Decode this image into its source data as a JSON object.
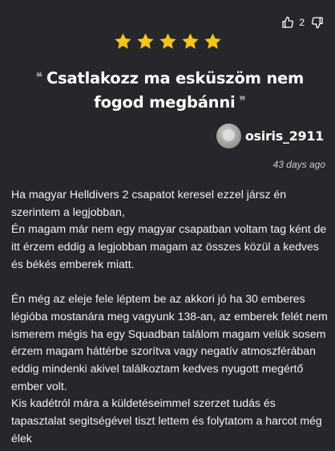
{
  "review": {
    "vote_count": "2",
    "rating": 5,
    "title": "Csatlakozz ma esküszöm nem fogod megbánni",
    "author": "osiris_2911",
    "date": "43 days ago",
    "body": "Ha magyar Helldivers 2 csapatot keresel ezzel jársz én szerintem a legjobban,\nÉn magam már nem egy magyar csapatban voltam tag ként de itt érzem eddig a legjobban magam az összes közül a kedves és békés emberek miatt.\n\nÉn még az eleje fele léptem be az akkori jó ha 30 emberes légióba mostanára meg vagyunk 138-an, az emberek felét nem ismerem mégis ha egy Squadban találom magam velük sosem érzem magam háttérbe szorítva vagy negatív atmoszférában eddig mindenki akivel találkoztam kedves nyugott megértő ember volt.\nKis kadétról mára a küldetéseimmel szerzet tudás és tapasztalat segitségével tiszt lettem és folytatom a harcot még élek"
  },
  "colors": {
    "background": "#26272b",
    "star": "#f5c518",
    "text": "#f1f1f3",
    "muted": "#8f9196"
  },
  "icons": {
    "upvote": "thumbs-up-icon",
    "downvote": "thumbs-down-icon",
    "star": "star-icon",
    "open_quote": "open-quote-icon",
    "close_quote": "close-quote-icon"
  }
}
